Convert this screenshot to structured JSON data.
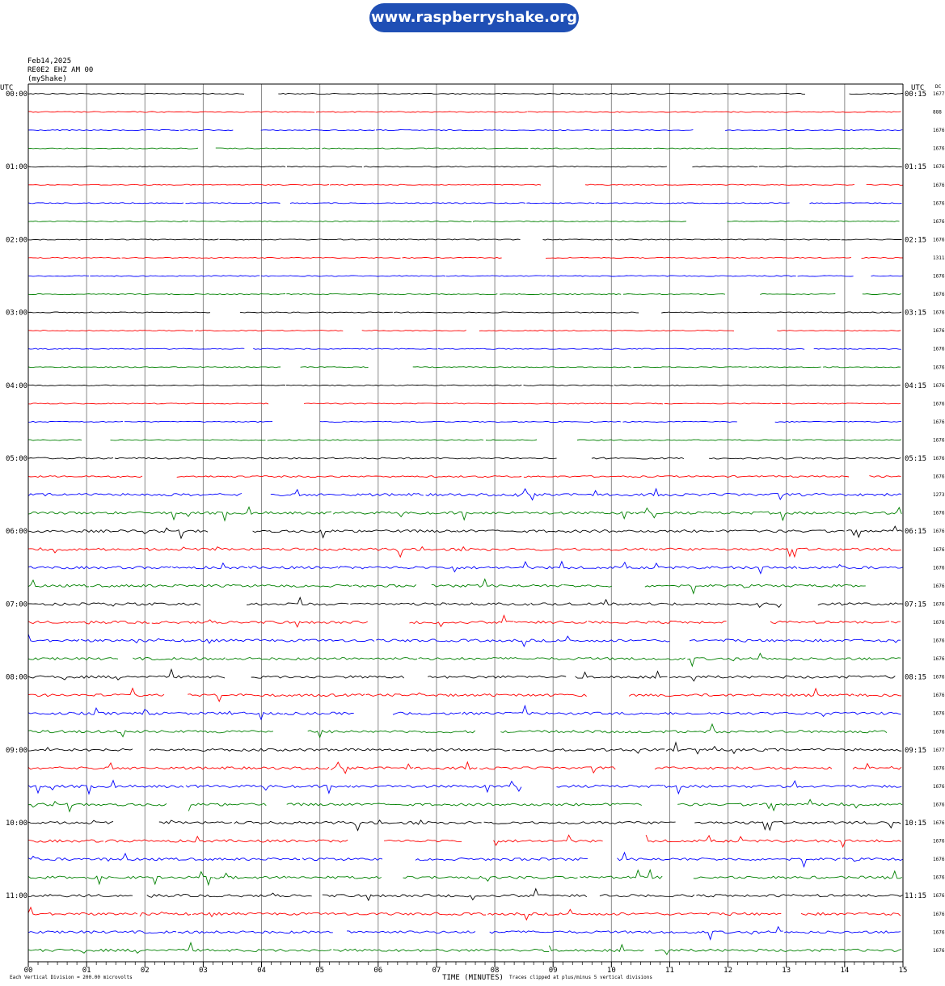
{
  "banner": {
    "url_text": "www.raspberryshake.org"
  },
  "header": {
    "date": "Feb14,2025",
    "station": "RE0E2 EHZ AM 00",
    "network": "(myShake)"
  },
  "chart_data": {
    "type": "line",
    "left_axis_title": "UTC",
    "right_axis_title": "UTC",
    "dc_column_title": "DC",
    "x_axis_title": "TIME (MINUTES)",
    "xlim": [
      0,
      15
    ],
    "x_tick_labels": [
      "00",
      "01",
      "02",
      "03",
      "04",
      "05",
      "06",
      "07",
      "08",
      "09",
      "10",
      "11",
      "12",
      "13",
      "14",
      "15"
    ],
    "left_time_labels": [
      "00:00",
      "01:00",
      "02:00",
      "03:00",
      "04:00",
      "05:00",
      "06:00",
      "07:00",
      "08:00",
      "09:00",
      "10:00",
      "11:00"
    ],
    "right_time_labels": [
      "00:15",
      "01:15",
      "02:15",
      "03:15",
      "04:15",
      "05:15",
      "06:15",
      "07:15",
      "08:15",
      "09:15",
      "10:15",
      "11:15"
    ],
    "dc_values": [
      "1677",
      "888",
      "1676",
      "1676",
      "1676",
      "1676",
      "1676",
      "1676",
      "1676",
      "1311",
      "1676",
      "1676",
      "1676",
      "1676",
      "1676",
      "1676",
      "1676",
      "1676",
      "1676",
      "1676",
      "1676",
      "1676",
      "1273",
      "1676",
      "1676",
      "1676",
      "1676",
      "1676",
      "1676",
      "1676",
      "1676",
      "1676",
      "1676",
      "1676",
      "1676",
      "1676",
      "1677",
      "1676",
      "1676",
      "1676",
      "1676",
      "1676",
      "1676",
      "1676",
      "1676",
      "1676",
      "1676",
      "1676"
    ],
    "trace_colors": [
      "#000000",
      "#ff0000",
      "#0000ff",
      "#008000"
    ],
    "traces_per_hour": 4,
    "trace_count": 48,
    "footer_left": "Each Vertical Division =   200.00 microvolts",
    "footer_right": "Traces clipped at plus/minus 5 vertical divisions",
    "grid": true
  }
}
